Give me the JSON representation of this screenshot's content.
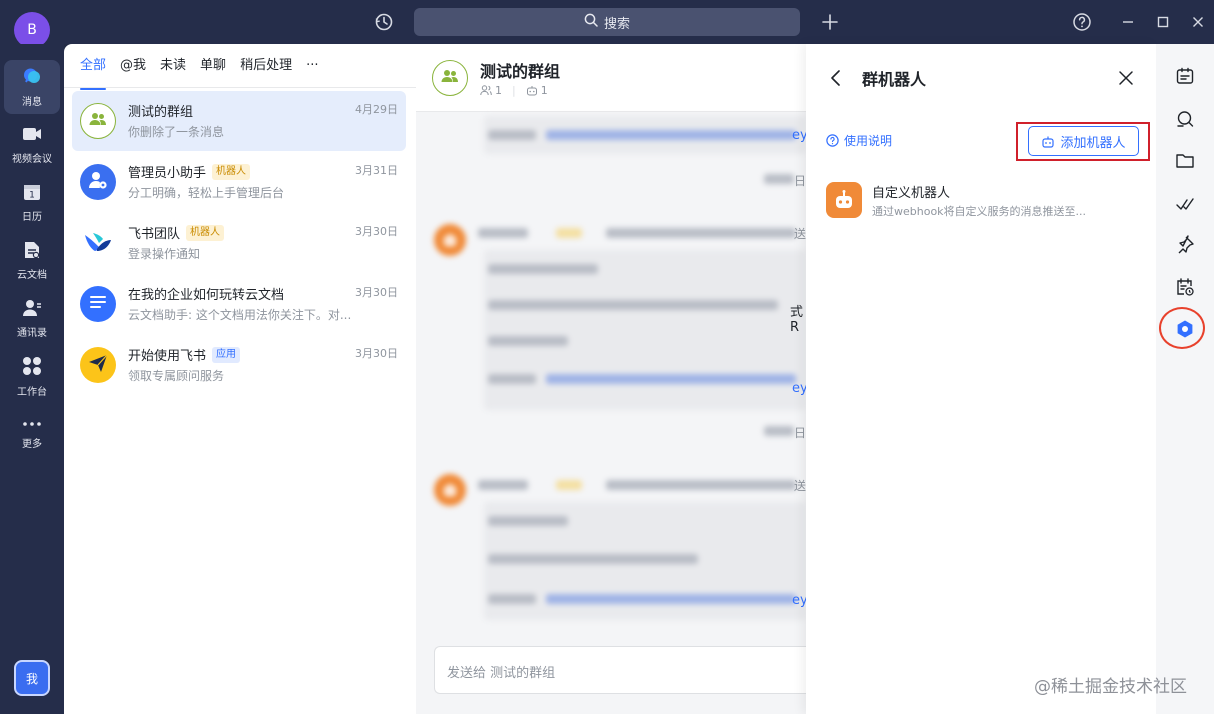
{
  "app": {
    "user_initial": "B",
    "search_placeholder": "搜索",
    "me_label": "我"
  },
  "nav": [
    {
      "label": "消息",
      "icon": "chat-bubble-icon"
    },
    {
      "label": "视频会议",
      "icon": "video-camera-icon"
    },
    {
      "label": "日历",
      "icon": "calendar-icon"
    },
    {
      "label": "云文档",
      "icon": "cloud-doc-icon"
    },
    {
      "label": "通讯录",
      "icon": "contacts-icon"
    },
    {
      "label": "工作台",
      "icon": "workplace-grid-icon"
    },
    {
      "label": "更多",
      "icon": "more-dots-icon"
    }
  ],
  "tabs": [
    "全部",
    "@我",
    "未读",
    "单聊",
    "稍后处理",
    "···"
  ],
  "chats": [
    {
      "title": "测试的群组",
      "badge": "",
      "subtitle": "你删除了一条消息",
      "date": "4月29日",
      "active": true
    },
    {
      "title": "管理员小助手",
      "badge": "机器人",
      "subtitle": "分工明确，轻松上手管理后台",
      "date": "3月31日"
    },
    {
      "title": "飞书团队",
      "badge": "机器人",
      "subtitle": "登录操作通知",
      "date": "3月30日"
    },
    {
      "title": "在我的企业如何玩转云文档",
      "badge": "",
      "subtitle": "云文档助手: 这个文档用法你关注下。对...",
      "date": "3月30日"
    },
    {
      "title": "开始使用飞书",
      "badge": "应用",
      "subtitle": "领取专属顾问服务",
      "date": "3月30日"
    }
  ],
  "chat_header": {
    "title": "测试的群组",
    "member_count": "1",
    "bot_count": "1"
  },
  "chat_body": {
    "partial_fragments": [
      "ey",
      "日",
      "送",
      "式R",
      "ey",
      "日",
      "送",
      "ey"
    ]
  },
  "compose": {
    "placeholder": "发送给 测试的群组"
  },
  "panel": {
    "title": "群机器人",
    "usage_link": "使用说明",
    "add_button": "添加机器人",
    "bots": [
      {
        "name": "自定义机器人",
        "description": "通过webhook将自定义服务的消息推送至..."
      }
    ]
  },
  "rail_icons": [
    "announcement-icon",
    "search-history-icon",
    "folder-icon",
    "checkmark-icon",
    "pin-icon",
    "schedule-icon",
    "settings-icon"
  ],
  "watermark": "@稀土掘金技术社区",
  "colors": {
    "accent": "#3370ff",
    "highlight_box": "#d0202b",
    "bot_orange": "#f08a38"
  }
}
